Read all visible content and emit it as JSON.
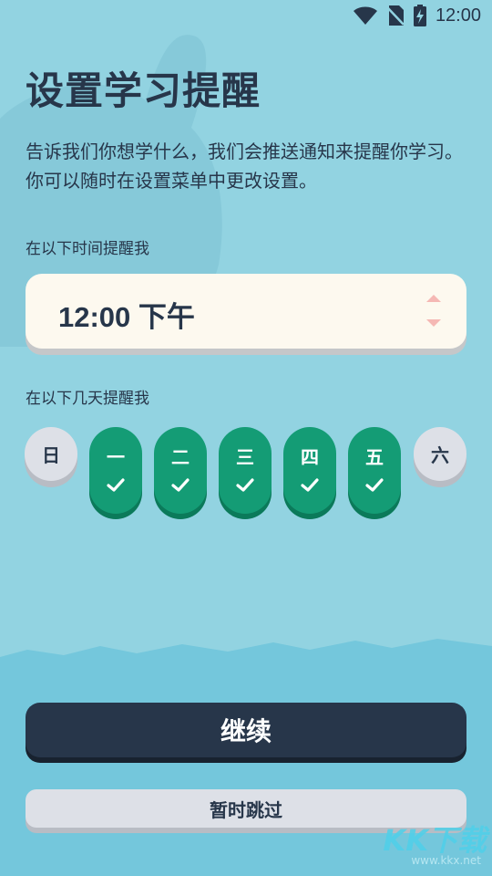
{
  "status_bar": {
    "time": "12:00",
    "icons": [
      "wifi-icon",
      "no-sim-icon",
      "battery-charging-icon"
    ]
  },
  "title": "设置学习提醒",
  "description": "告诉我们你想学什么，我们会推送通知来提醒你学习。你可以随时在设置菜单中更改设置。",
  "time_section": {
    "label": "在以下时间提醒我",
    "value": "12:00 下午"
  },
  "days_section": {
    "label": "在以下几天提醒我",
    "days": [
      {
        "label": "日",
        "selected": false
      },
      {
        "label": "一",
        "selected": true
      },
      {
        "label": "二",
        "selected": true
      },
      {
        "label": "三",
        "selected": true
      },
      {
        "label": "四",
        "selected": true
      },
      {
        "label": "五",
        "selected": true
      },
      {
        "label": "六",
        "selected": false
      }
    ]
  },
  "actions": {
    "continue_label": "继续",
    "skip_label": "暂时跳过"
  },
  "watermark": {
    "title": "KK下载",
    "url": "www.kkx.net"
  },
  "colors": {
    "background": "#92d3e1",
    "primary_green": "#149c75",
    "dark": "#27364a",
    "card": "#fdf9ef",
    "inactive": "#dde0e7"
  }
}
